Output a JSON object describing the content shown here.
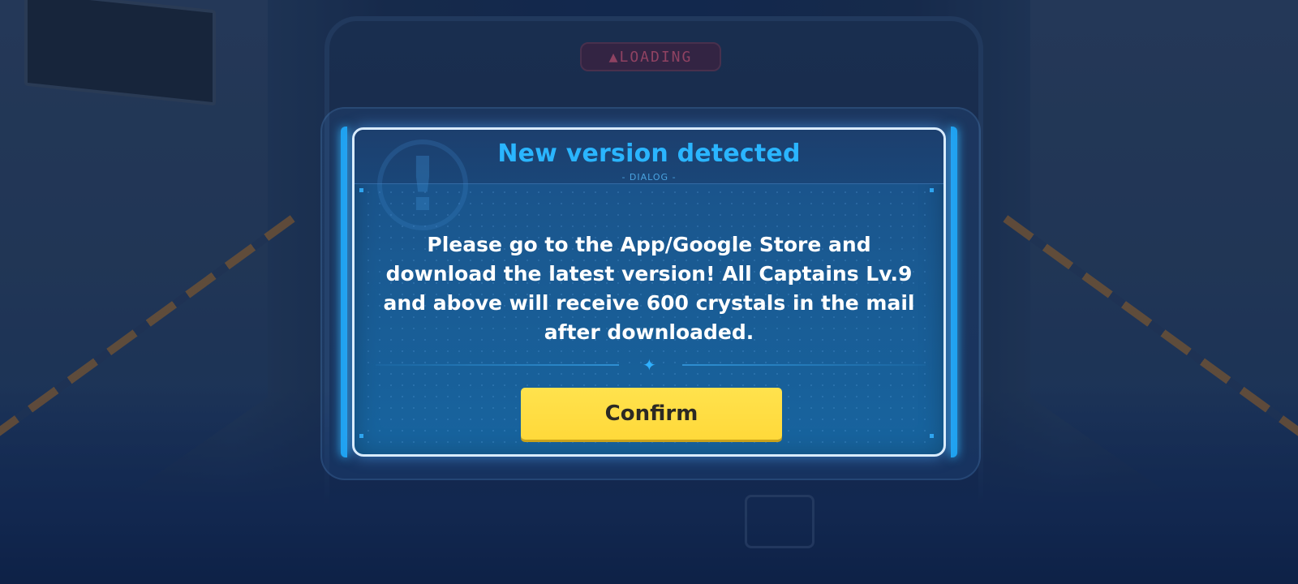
{
  "background": {
    "sign_text": "▲LOADING"
  },
  "dialog": {
    "title": "New version detected",
    "subtitle": "- DIALOG -",
    "alert_icon": "exclamation-icon",
    "message": "Please go to the App/Google Store and download the latest version! All Captains Lv.9 and above will receive 600 crystals in the mail after downloaded.",
    "divider_icon": "sparkle-icon",
    "confirm_label": "Confirm"
  },
  "colors": {
    "title": "#2ab5ff",
    "panel": "#1a5a92",
    "border": "#d9ecff",
    "confirm_button": "#ffde44"
  }
}
